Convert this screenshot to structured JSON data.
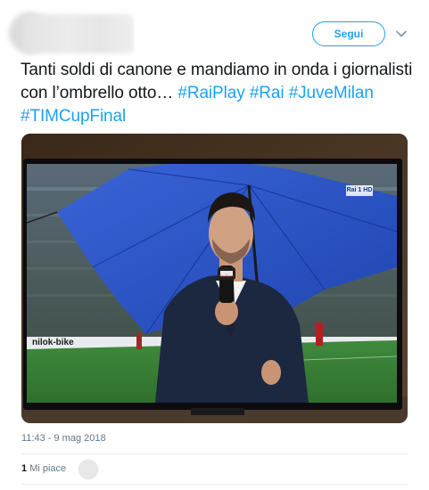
{
  "header": {
    "follow_label": "Segui",
    "icons": [
      "chevron-down-icon"
    ]
  },
  "tweet": {
    "segments": [
      {
        "text": "Tanti soldi di canone e mandiamo in onda i giornalisti con l’ombrello otto… ",
        "hashtag": false
      },
      {
        "text": "#RaiPlay",
        "hashtag": true
      },
      {
        "text": " ",
        "hashtag": false
      },
      {
        "text": "#Rai",
        "hashtag": true
      },
      {
        "text": " ",
        "hashtag": false
      },
      {
        "text": "#JuveMilan",
        "hashtag": true
      },
      {
        "text": " ",
        "hashtag": false
      },
      {
        "text": "#TIMCupFinal",
        "hashtag": true
      }
    ]
  },
  "photo": {
    "channel_logo": "Rai 1 HD",
    "mic_logo": "Rai Sport",
    "ad_board": "nilok-bike"
  },
  "meta": {
    "timestamp": "11:43 - 9 mag 2018",
    "likes_count": "1",
    "likes_label": "Mi piace"
  },
  "colors": {
    "link": "#1da1f2",
    "text": "#14171a",
    "muted": "#657786",
    "umbrella": "#2a55c8"
  }
}
